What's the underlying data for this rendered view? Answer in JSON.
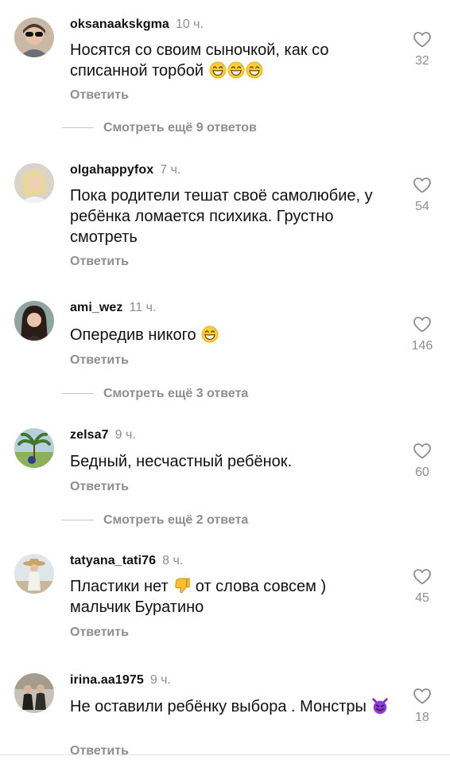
{
  "reply_label": "Ответить",
  "comments": [
    {
      "username": "oksanaakskgma",
      "time": "10 ч.",
      "text": "Носятся со своим сыночкой, как со списанной торбой",
      "likes": "32",
      "emoji": "grinning-sweat-emoji",
      "emoji_count": 3,
      "avatar": "woman-sunglasses-avatar"
    },
    {
      "username": "olgahappyfox",
      "time": "7 ч.",
      "text": "Пока родители тешат своё самолюбие, у ребёнка ломается психика. Грустно смотреть",
      "likes": "54",
      "avatar": "blonde-woman-avatar"
    },
    {
      "username": "ami_wez",
      "time": "11 ч.",
      "text": "Опередив никого",
      "likes": "146",
      "emoji": "grinning-sweat-emoji",
      "emoji_count": 1,
      "avatar": "dark-hair-woman-avatar"
    },
    {
      "username": "zelsa7",
      "time": "9 ч.",
      "text": "Бедный, несчастный ребёнок.",
      "likes": "60",
      "avatar": "palm-tree-avatar"
    },
    {
      "username": "tatyana_tati76",
      "time": "8 ч.",
      "text_before": "Пластики нет",
      "text_after": "от слова совсем ) мальчик Буратино",
      "likes": "45",
      "emoji": "thumbs-down-emoji",
      "avatar": "woman-hat-beach-avatar"
    },
    {
      "username": "irina.aa1975",
      "time": "9 ч.",
      "text": "Не оставили ребёнку выбора . Монстры",
      "likes": "18",
      "emoji": "devil-face-emoji",
      "avatar": "people-room-avatar"
    }
  ],
  "more_replies": [
    "Смотреть ещё 9 ответов",
    "Смотреть ещё 3 ответа",
    "Смотреть ещё 2 ответа"
  ],
  "colors": {
    "text": "#111111",
    "muted": "#8e8e8e",
    "divider": "#c7c7c7",
    "background": "#ffffff"
  }
}
